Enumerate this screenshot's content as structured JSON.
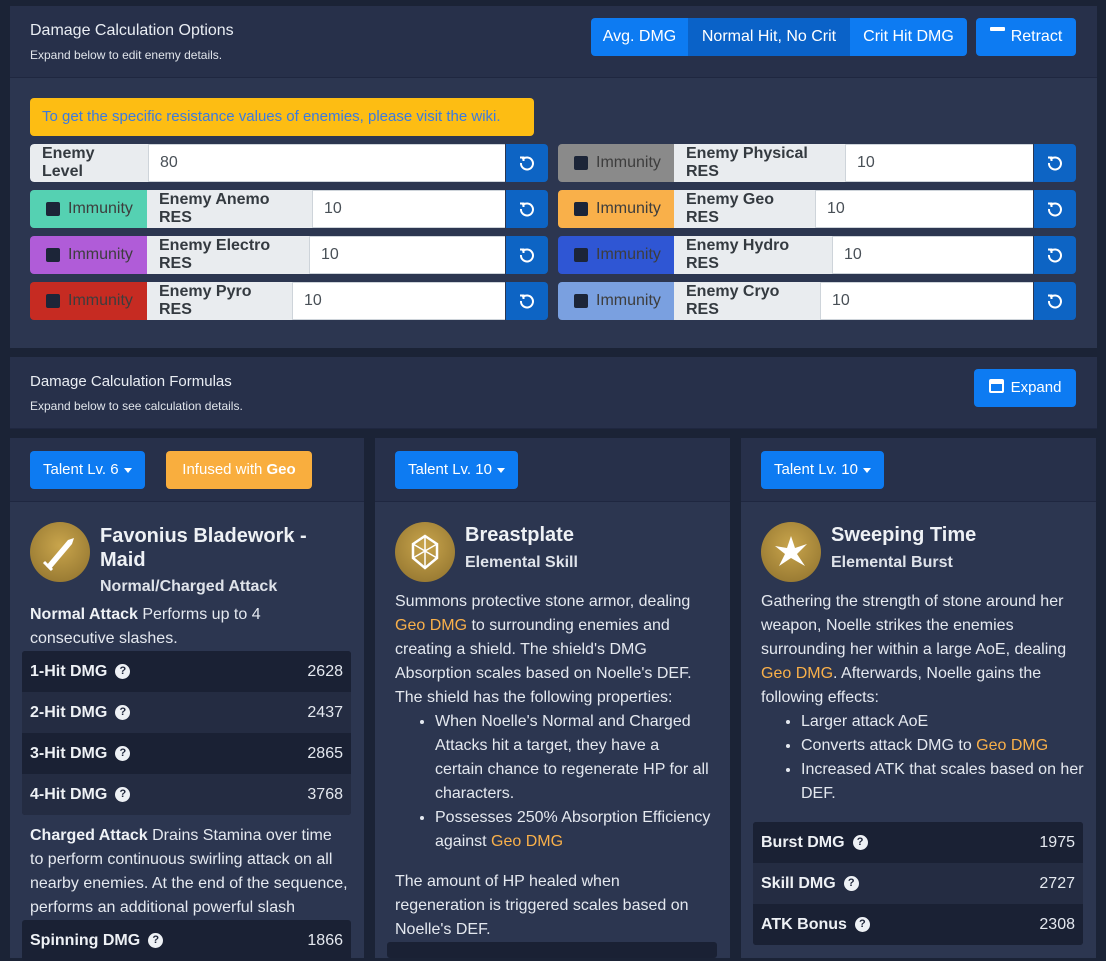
{
  "options": {
    "title": "Damage Calculation Options",
    "subtitle": "Expand below to edit enemy details.",
    "modes": [
      "Avg. DMG",
      "Normal Hit, No Crit",
      "Crit Hit DMG"
    ],
    "active_mode": "Normal Hit, No Crit",
    "retract_label": "Retract"
  },
  "warning": "To get the specific resistance values of enemies, please visit the wiki.",
  "enemy": {
    "level_label": "Enemy Level",
    "level_value": "80",
    "immunity_label": "Immunity",
    "res": [
      {
        "label": "Enemy Physical RES",
        "value": "10",
        "color": "#8a8a8a"
      },
      {
        "label": "Enemy Anemo RES",
        "value": "10",
        "color": "#55d1b2"
      },
      {
        "label": "Enemy Geo RES",
        "value": "10",
        "color": "#f9b04a"
      },
      {
        "label": "Enemy Electro RES",
        "value": "10",
        "color": "#b05cd8"
      },
      {
        "label": "Enemy Hydro RES",
        "value": "10",
        "color": "#2f56d4"
      },
      {
        "label": "Enemy Pyro RES",
        "value": "10",
        "color": "#c62b22"
      },
      {
        "label": "Enemy Cryo RES",
        "value": "10",
        "color": "#7aa0e0"
      }
    ]
  },
  "formulas": {
    "title": "Damage Calculation Formulas",
    "subtitle": "Expand below to see calculation details.",
    "expand_label": "Expand"
  },
  "cards": [
    {
      "talent": "Talent Lv. 6",
      "infused_prefix": "Infused with ",
      "infused_element": "Geo",
      "name_line1": "Favonius Bladework -",
      "name_line2": "Maid",
      "type": "Normal/Charged Attack",
      "na_title": "Normal Attack",
      "na_text": " Performs up to 4",
      "na_text2": "consecutive slashes.",
      "stats": [
        {
          "name": "1-Hit DMG",
          "value": "2628"
        },
        {
          "name": "2-Hit DMG",
          "value": "2437"
        },
        {
          "name": "3-Hit DMG",
          "value": "2865"
        },
        {
          "name": "4-Hit DMG",
          "value": "3768"
        }
      ],
      "ca_title": "Charged Attack",
      "ca_lines": [
        " Drains Stamina over time",
        "to perform continuous swirling attack on all",
        "nearby enemies. At the end of the sequence,",
        "performs an additional powerful slash"
      ],
      "stats2": [
        {
          "name": "Spinning DMG",
          "value": "1866"
        }
      ]
    },
    {
      "talent": "Talent Lv. 10",
      "name": "Breastplate",
      "type": "Elemental Skill",
      "lines": [
        "Summons protective stone armor, dealing",
        "Geo DMG",
        " to surrounding enemies and",
        "creating a shield. The shield's DMG",
        "Absorption scales based on Noelle's DEF.",
        "The shield has the following properties:"
      ],
      "bullets": [
        [
          "When Noelle's Normal and Charged",
          "Attacks hit a target, they have a",
          "certain chance to regenerate HP for all",
          "characters."
        ],
        [
          "Possesses 250% Absorption Efficiency",
          "against ",
          "Geo DMG"
        ]
      ],
      "tail": [
        "The amount of HP healed when",
        "regeneration is triggered scales based on",
        "Noelle's DEF."
      ]
    },
    {
      "talent": "Talent Lv. 10",
      "name": "Sweeping Time",
      "type": "Elemental Burst",
      "lines": [
        "Gathering the strength of stone around her",
        "weapon, Noelle strikes the enemies",
        "surrounding her within a large AoE, dealing",
        "Geo DMG",
        ". Afterwards, Noelle gains the",
        "following effects:"
      ],
      "bullets": [
        "Larger attack AoE",
        "Converts attack DMG to ",
        "Geo DMG",
        "Increased ATK that scales based on her",
        "DEF."
      ],
      "stats": [
        {
          "name": "Burst DMG",
          "value": "1975"
        },
        {
          "name": "Skill DMG",
          "value": "2727"
        },
        {
          "name": "ATK Bonus",
          "value": "2308"
        }
      ]
    }
  ]
}
